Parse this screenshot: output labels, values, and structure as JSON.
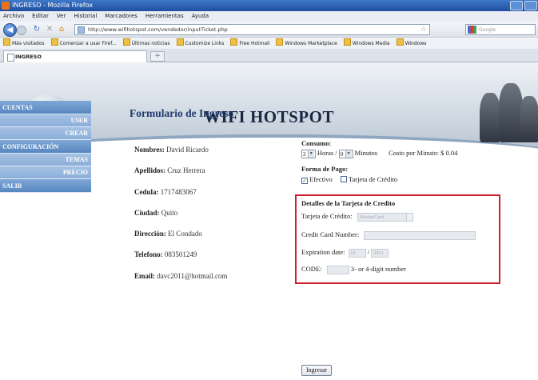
{
  "window": {
    "title": "INGRESO - Mozilla Firefox"
  },
  "menu": [
    "Archivo",
    "Editar",
    "Ver",
    "Historial",
    "Marcadores",
    "Herramientas",
    "Ayuda"
  ],
  "address": {
    "url": "http://www.wifihotspot.com/vendedor/inputTicket.php",
    "search_placeholder": "Google"
  },
  "bookmarks": [
    "Más visitados",
    "Comenzar a usar Firef...",
    "Últimas noticias",
    "Customize Links",
    "Free Hotmail",
    "Windows Marketplace",
    "Windows Media",
    "Windows"
  ],
  "tab": {
    "label": "INGRESO",
    "new_tab": "+"
  },
  "banner": {
    "title": "WIFI HOTSPOT"
  },
  "sidebar": {
    "cuentas": "CUENTAS",
    "user": "USER",
    "crear": "CREAR",
    "configuracion": "CONFIGURACIÓN",
    "temas": "TEMAS",
    "precio": "PRECIO",
    "salir": "SALIR"
  },
  "form": {
    "title": "Formulario de Ingreso",
    "nombres_label": "Nombres:",
    "nombres_value": "David Ricardo",
    "apellidos_label": "Apellidos:",
    "apellidos_value": "Cruz Herrera",
    "cedula_label": "Cedula:",
    "cedula_value": "1717483067",
    "ciudad_label": "Ciudad:",
    "ciudad_value": "Quito",
    "direccion_label": "Dirección:",
    "direccion_value": "El Condado",
    "telefono_label": "Telefono:",
    "telefono_value": "083501249",
    "email_label": "Email:",
    "email_value": "davc2011@hotmail.com"
  },
  "consumo": {
    "label": "Consumo:",
    "horas_value": "2",
    "horas_label": "Horas /",
    "minutos_value": "0",
    "minutos_label": "Minutos",
    "costo": "Costo por Minuto: $ 0.04"
  },
  "pago": {
    "label": "Forma de Pago:",
    "efectivo": "Efectivo",
    "tarjeta": "Tarjeta de Crédito"
  },
  "tarjeta": {
    "title": "Detalles de la Tarjeta de Credito",
    "tipo_label": "Tarjeta de Crédito:",
    "tipo_value": "MasterCard",
    "number_label": "Credit Card Number:",
    "expiration_label": "Expiration date:",
    "exp_month": "01",
    "exp_sep": "/",
    "exp_year": "2011",
    "code_label": "CODE:",
    "code_hint": "3- or 4-digit number"
  },
  "submit": "Ingresar"
}
